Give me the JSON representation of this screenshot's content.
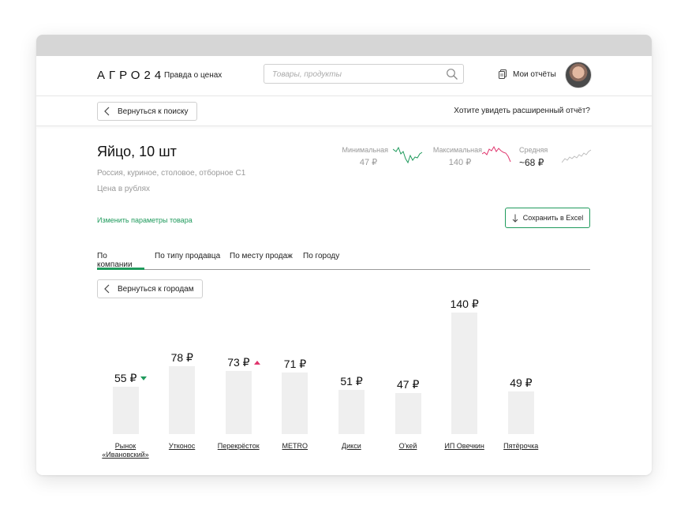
{
  "header": {
    "logo": "АГРО24",
    "slogan": "Правда о ценах",
    "search_placeholder": "Товары, продукты",
    "reports_label": "Мои отчёты"
  },
  "subbar": {
    "back_label": "Вернуться к поиску",
    "extended_label": "Хотите увидеть расширенный отчёт?"
  },
  "product": {
    "title": "Яйцо, 10 шт",
    "description": "Россия, куриное, столовое, отборное С1",
    "price_unit": "Цена в рублях",
    "change_link": "Изменить параметры товара",
    "excel_label": "Сохранить в Excel"
  },
  "stats": [
    {
      "label": "Минимальная",
      "value": "47 ₽",
      "color": "#1f9a5c"
    },
    {
      "label": "Максимальная",
      "value": "140 ₽",
      "color": "#e0356d"
    },
    {
      "label": "Средняя",
      "value": "~68 ₽",
      "color": "#bdbdbd"
    }
  ],
  "tabs": [
    {
      "label": "По компании",
      "active": true
    },
    {
      "label": "По типу продавца",
      "active": false
    },
    {
      "label": "По месту продаж",
      "active": false
    },
    {
      "label": "По городу",
      "active": false
    }
  ],
  "back_cities_label": "Вернуться к городам",
  "chart_data": {
    "type": "bar",
    "categories": [
      "Рынок «Ивановский»",
      "Утконос",
      "Перекрёсток",
      "METRO",
      "Дикси",
      "О'кей",
      "ИП Овечкин",
      "Пятёрочка"
    ],
    "values": [
      55,
      78,
      73,
      71,
      51,
      47,
      140,
      49
    ],
    "value_labels": [
      "55 ₽",
      "78 ₽",
      "73 ₽",
      "71 ₽",
      "51 ₽",
      "47 ₽",
      "140 ₽",
      "49 ₽"
    ],
    "markers": [
      "down",
      "",
      "up",
      "",
      "",
      "",
      "",
      ""
    ],
    "bar_color": "#efefef",
    "ylim": [
      0,
      140
    ]
  },
  "colors": {
    "accent": "#1f9a5c",
    "up": "#e0356d"
  }
}
